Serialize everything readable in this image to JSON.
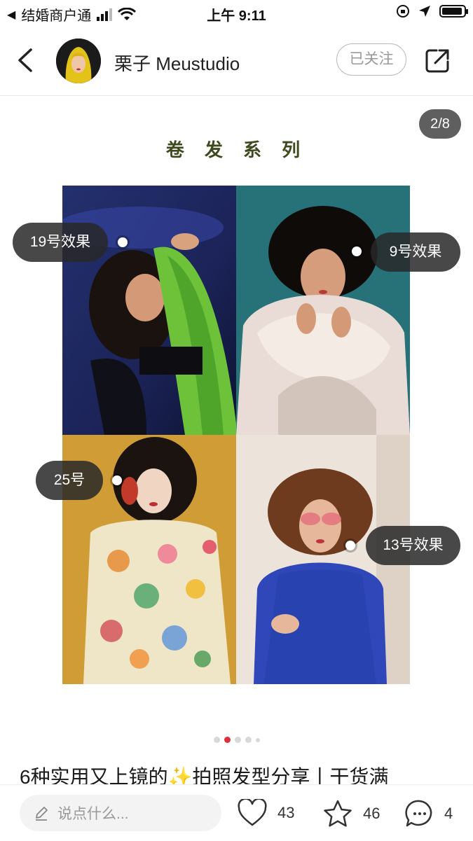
{
  "status_bar": {
    "carrier": "结婚商户通",
    "time": "上午 9:11"
  },
  "header": {
    "author_name": "栗子 Meustudio",
    "follow_label": "已关注"
  },
  "post": {
    "image_title": "卷 发 系 列",
    "image_counter": "2/8",
    "tags": [
      {
        "label": "19号效果"
      },
      {
        "label": "9号效果"
      },
      {
        "label": "25号"
      },
      {
        "label": "13号效果"
      }
    ],
    "pager": {
      "total": 5,
      "active": 1
    },
    "caption": "6种实用又上镜的✨拍照发型分享丨干货满"
  },
  "bottom_bar": {
    "comment_placeholder": "说点什么...",
    "like_count": "43",
    "collect_count": "46",
    "comment_count": "4"
  },
  "colors": {
    "accent_red": "#e0303a",
    "title_green": "#3d4a1e",
    "tag_bg": "#282828"
  },
  "icons": [
    "back-icon",
    "share-icon",
    "heart-icon",
    "star-icon",
    "comment-icon",
    "pencil-icon",
    "wifi-icon",
    "location-arrow-icon",
    "orientation-lock-icon"
  ]
}
